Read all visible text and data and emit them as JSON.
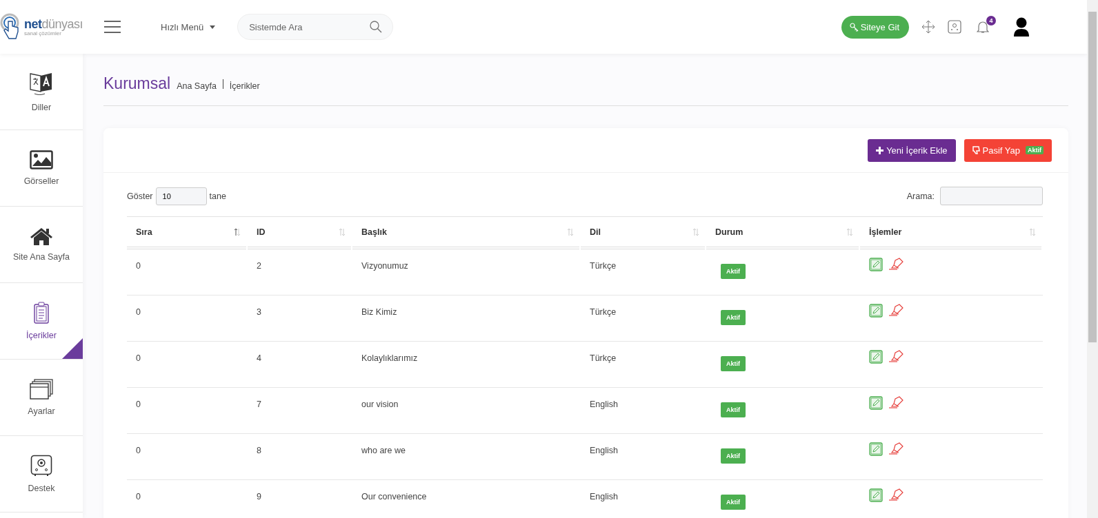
{
  "logo": {
    "brand_bold": "net",
    "brand_light": "dünyası",
    "tagline": "sanal çözümler"
  },
  "header": {
    "quick_menu": "Hızlı Menü",
    "search": {
      "placeholder": "Sistemde Ara"
    },
    "site_button": "Siteye Git",
    "notification_count": "4"
  },
  "sidebar": {
    "items": [
      {
        "label": "Diller",
        "kind": "translate",
        "selected": false
      },
      {
        "label": "Görseller",
        "kind": "image",
        "selected": false
      },
      {
        "label": "Site Ana Sayfa",
        "kind": "home",
        "selected": false
      },
      {
        "label": "İçerikler",
        "kind": "clipboard",
        "selected": true
      },
      {
        "label": "Ayarlar",
        "kind": "windows",
        "selected": false
      },
      {
        "label": "Destek",
        "kind": "safe",
        "selected": false
      }
    ]
  },
  "page": {
    "title": "Kurumsal",
    "breadcrumb": [
      "Ana Sayfa",
      "İçerikler"
    ]
  },
  "toolbar": {
    "buttons": [
      {
        "label": "Yeni İçerik Ekle",
        "kind": "add"
      },
      {
        "label": "Pasif Yap",
        "kind": "deactivate",
        "badge": "Aktif"
      }
    ]
  },
  "table_controls": {
    "show_label": "Göster",
    "page_size": "10",
    "show_suffix": "tane",
    "search_label": "Arama:"
  },
  "table": {
    "columns": [
      {
        "label": "Sıra",
        "sorted": true
      },
      {
        "label": "ID",
        "sorted": false
      },
      {
        "label": "Başlık",
        "sorted": false
      },
      {
        "label": "Dil",
        "sorted": false
      },
      {
        "label": "Durum",
        "sorted": false
      },
      {
        "label": "İşlemler",
        "sorted": false
      }
    ],
    "rows": [
      {
        "order": "0",
        "id": "2",
        "title": "Vizyonumuz",
        "language": "Türkçe",
        "status": "Aktif"
      },
      {
        "order": "0",
        "id": "3",
        "title": "Biz Kimiz",
        "language": "Türkçe",
        "status": "Aktif"
      },
      {
        "order": "0",
        "id": "4",
        "title": "Kolaylıklarımız",
        "language": "Türkçe",
        "status": "Aktif"
      },
      {
        "order": "0",
        "id": "7",
        "title": "our vision",
        "language": "English",
        "status": "Aktif"
      },
      {
        "order": "0",
        "id": "8",
        "title": "who are we",
        "language": "English",
        "status": "Aktif"
      },
      {
        "order": "0",
        "id": "9",
        "title": "Our convenience",
        "language": "English",
        "status": "Aktif"
      }
    ]
  }
}
